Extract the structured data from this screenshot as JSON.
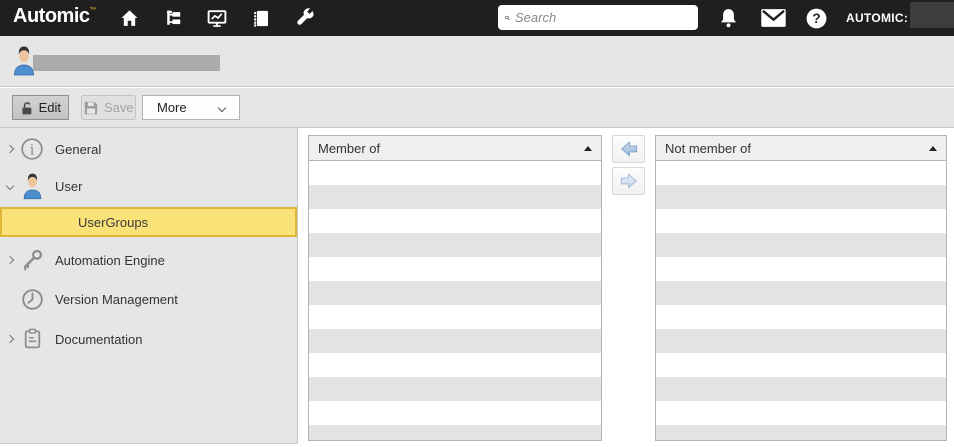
{
  "topbar": {
    "logo_text": "Automic",
    "logo_tm": "™",
    "nav_icons": [
      "home-icon",
      "process-assembly-icon",
      "process-monitoring-icon",
      "catalog-icon",
      "administration-wrench-icon"
    ],
    "search_placeholder": "Search",
    "right_icons": [
      "notifications-bell-icon",
      "messages-mail-icon",
      "help-icon"
    ],
    "account_label": "AUTOMIC:"
  },
  "toolbar": {
    "edit_label": "Edit",
    "save_label": "Save",
    "more_label": "More"
  },
  "sidebar": {
    "items": [
      {
        "label": "General",
        "icon": "info-icon",
        "expandable": true,
        "expanded": false,
        "selected": false
      },
      {
        "label": "User",
        "icon": "user-avatar-icon",
        "expandable": true,
        "expanded": true,
        "selected": false
      },
      {
        "label": "UserGroups",
        "icon": null,
        "expandable": false,
        "expanded": false,
        "selected": true
      },
      {
        "label": "Automation Engine",
        "icon": "key-icon",
        "expandable": true,
        "expanded": false,
        "selected": false
      },
      {
        "label": "Version Management",
        "icon": "clock-icon",
        "expandable": false,
        "expanded": false,
        "selected": false
      },
      {
        "label": "Documentation",
        "icon": "clipboard-icon",
        "expandable": true,
        "expanded": false,
        "selected": false
      }
    ]
  },
  "main": {
    "member_panel": {
      "title": "Member of",
      "sort": "ascending",
      "row_count": 12,
      "rows": []
    },
    "not_member_panel": {
      "title": "Not member of",
      "sort": "ascending",
      "row_count": 12,
      "rows": []
    },
    "transfer_icons": [
      "arrow-left-icon",
      "arrow-right-icon"
    ]
  },
  "colors": {
    "topbar_bg": "#1f1f1f",
    "chrome_bg": "#e6e6e6",
    "selection_fill": "#fae178",
    "selection_border": "#dfb637",
    "stripe": "#e3e3e3",
    "panel_border": "#b3b3b3",
    "arrow_blue": "#a9c6e4"
  }
}
